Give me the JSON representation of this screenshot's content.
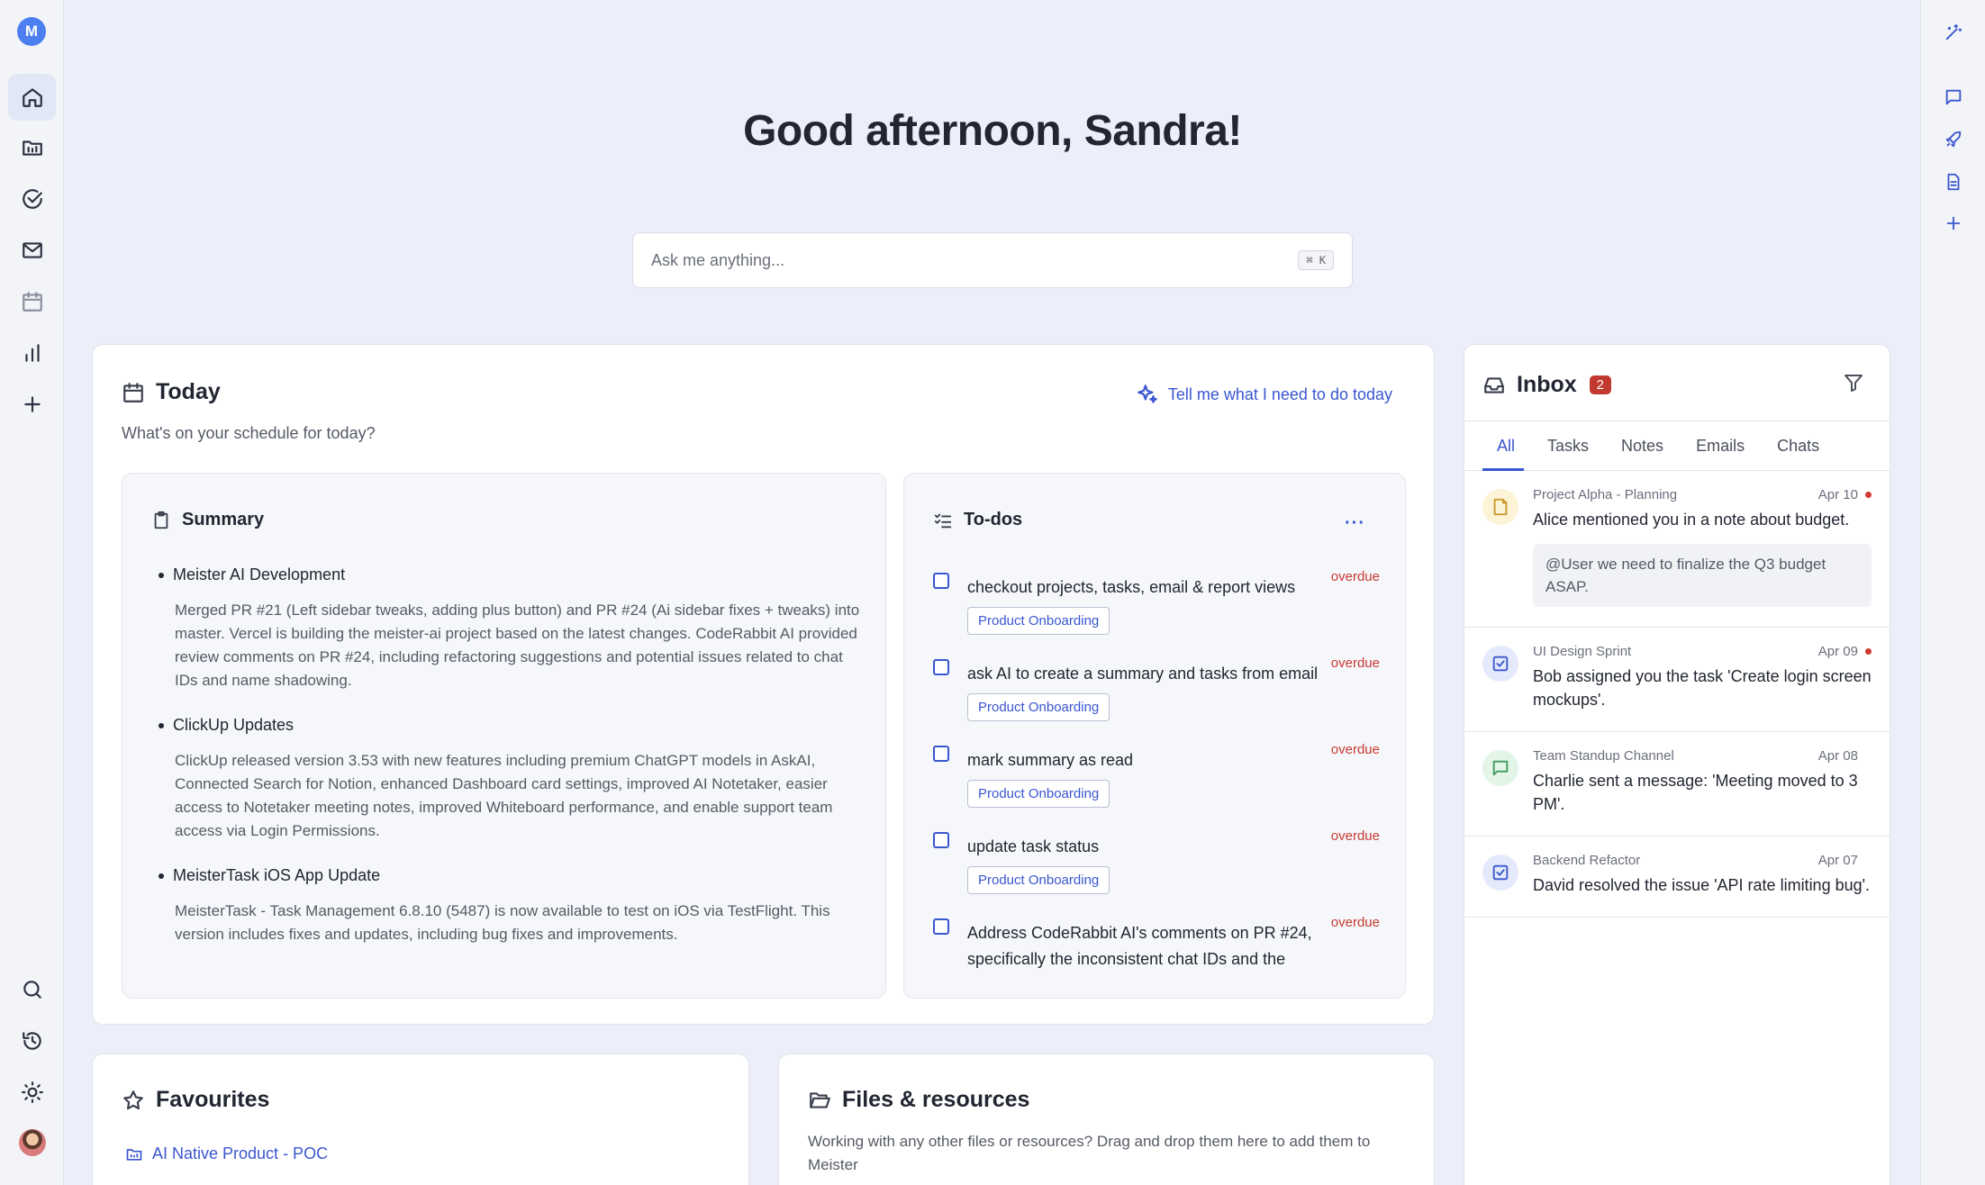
{
  "app": {
    "logo_letter": "M"
  },
  "greeting": "Good afternoon, Sandra!",
  "search": {
    "placeholder": "Ask me anything...",
    "shortcut": "⌘ K"
  },
  "today": {
    "title": "Today",
    "subtitle": "What's on your schedule for today?",
    "action_label": "Tell me what I need to do today",
    "summary": {
      "title": "Summary",
      "items": [
        {
          "heading": "Meister AI Development",
          "body": "Merged PR #21 (Left sidebar tweaks, adding plus button) and PR #24 (Ai sidebar fixes + tweaks) into master. Vercel is building the meister-ai project based on the latest changes. CodeRabbit AI provided review comments on PR #24, including refactoring suggestions and potential issues related to chat IDs and name shadowing."
        },
        {
          "heading": "ClickUp Updates",
          "body": "ClickUp released version 3.53 with new features including premium ChatGPT models in AskAI, Connected Search for Notion, enhanced Dashboard card settings, improved AI Notetaker, easier access to Notetaker meeting notes, improved Whiteboard performance, and enable support team access via Login Permissions."
        },
        {
          "heading": "MeisterTask iOS App Update",
          "body": "MeisterTask - Task Management 6.8.10 (5487) is now available to test on iOS via TestFlight. This version includes fixes and updates, including bug fixes and improvements."
        }
      ]
    },
    "todos": {
      "title": "To-dos",
      "more_label": "···",
      "items": [
        {
          "text": "checkout projects, tasks, email & report views",
          "status": "overdue",
          "tag": "Product Onboarding"
        },
        {
          "text": "ask AI to create a summary and tasks from email",
          "status": "overdue",
          "tag": "Product Onboarding"
        },
        {
          "text": "mark summary as read",
          "status": "overdue",
          "tag": "Product Onboarding"
        },
        {
          "text": "update task status",
          "status": "overdue",
          "tag": "Product Onboarding"
        },
        {
          "text": "Address CodeRabbit AI's comments on PR #24, specifically the inconsistent chat IDs and the",
          "status": "overdue",
          "tag": ""
        }
      ]
    }
  },
  "favourites": {
    "title": "Favourites",
    "items": [
      {
        "label": "AI Native Product - POC"
      }
    ]
  },
  "files": {
    "title": "Files & resources",
    "description": "Working with any other files or resources? Drag and drop them here to add them to Meister"
  },
  "inbox": {
    "title": "Inbox",
    "count": "2",
    "tabs": [
      "All",
      "Tasks",
      "Notes",
      "Emails",
      "Chats"
    ],
    "active_tab": "All",
    "items": [
      {
        "type": "note-icon",
        "source": "Project Alpha - Planning",
        "date": "Apr 10",
        "unread": true,
        "message": "Alice mentioned you in a note about budget.",
        "quote": "@User we need to finalize the Q3 budget ASAP."
      },
      {
        "type": "task-icon",
        "source": "UI Design Sprint",
        "date": "Apr 09",
        "unread": true,
        "message": "Bob assigned you the task 'Create login screen mockups'.",
        "quote": ""
      },
      {
        "type": "chat-icon",
        "source": "Team Standup Channel",
        "date": "Apr 08",
        "unread": false,
        "message": "Charlie sent a message: 'Meeting moved to 3 PM'.",
        "quote": ""
      },
      {
        "type": "task-icon",
        "source": "Backend Refactor",
        "date": "Apr 07",
        "unread": false,
        "message": "David resolved the issue 'API rate limiting bug'.",
        "quote": ""
      }
    ]
  },
  "colors": {
    "accent": "#3a56d0",
    "overdue": "#c73a33",
    "badge": "#c23a2f",
    "background": "#eceff9"
  }
}
